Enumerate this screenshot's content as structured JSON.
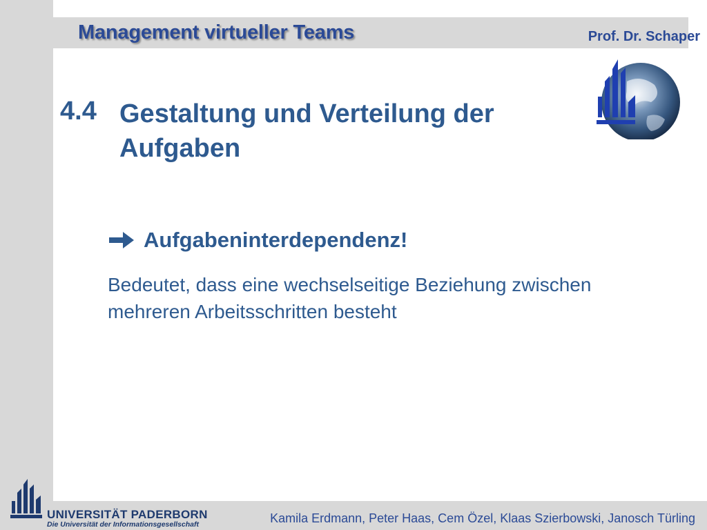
{
  "header": {
    "title": "Management virtueller Teams",
    "author": "Prof. Dr. Schaper"
  },
  "section": {
    "number": "4.4",
    "title": "Gestaltung und Verteilung der Aufgaben"
  },
  "content": {
    "key_point": "Aufgabeninterdependenz!",
    "description": "Bedeutet, dass eine wechselseitige Beziehung zwischen mehreren Arbeitsschritten besteht"
  },
  "footer": {
    "university_name": "UNIVERSITÄT PADERBORN",
    "university_tagline": "Die Universität der Informationsgesellschaft",
    "authors": "Kamila Erdmann, Peter Haas, Cem Özel, Klaas Szierbowski, Janosch Türling"
  },
  "icons": {
    "logo": "university-globe-logo-icon",
    "bullet": "arrow-right-icon",
    "footer_logo": "university-mark-icon"
  },
  "colors": {
    "primary_blue": "#2e5a8f",
    "header_blue": "#2b4a96",
    "panel_gray": "#d8d8d8"
  }
}
